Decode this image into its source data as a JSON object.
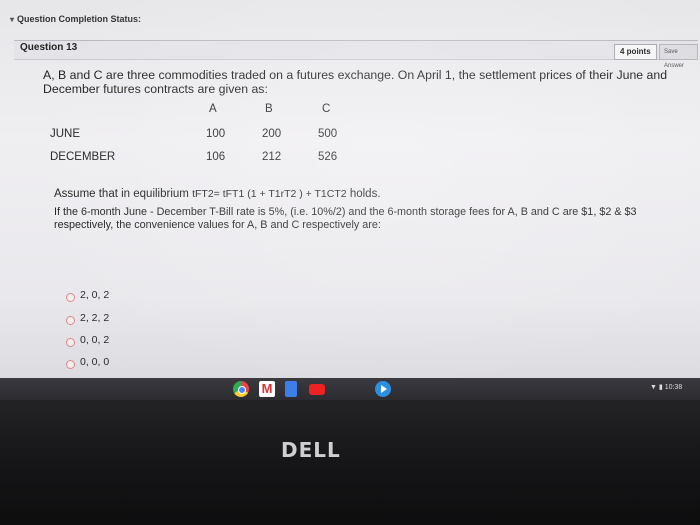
{
  "header": {
    "completion_status": "Question Completion Status:"
  },
  "question": {
    "title": "Question 13",
    "points": "4 points",
    "save_label": "Save Answer",
    "intro": "A, B and C are three commodities traded on a futures exchange. On April 1, the settlement prices of their June and December futures contracts are given as:",
    "table": {
      "columns": [
        "A",
        "B",
        "C"
      ],
      "rows": [
        {
          "label": "JUNE",
          "values": [
            "100",
            "200",
            "500"
          ]
        },
        {
          "label": "DECEMBER",
          "values": [
            "106",
            "212",
            "526"
          ]
        }
      ]
    },
    "assume_text": "Assume that in equilibrium",
    "formula": "tFT2= tFT1 (1 + T1rT2 ) + T1CT2",
    "holds_text": "holds.",
    "prompt": "If the 6-month June - December T-Bill rate is 5%, (i.e. 10%/2) and the 6-month storage fees for A, B and C are $1, $2 & $3 respectively, the convenience values for A, B and C respectively are:",
    "choices": [
      "2, 0, 2",
      "2, 2, 2",
      "0, 0, 2",
      "0, 0, 0"
    ]
  },
  "shelf": {
    "apps": [
      "chrome-icon",
      "gmail-icon",
      "docs-icon",
      "youtube-icon",
      "play-icon"
    ],
    "time": "10:38"
  },
  "laptop": {
    "brand": "DELL"
  }
}
